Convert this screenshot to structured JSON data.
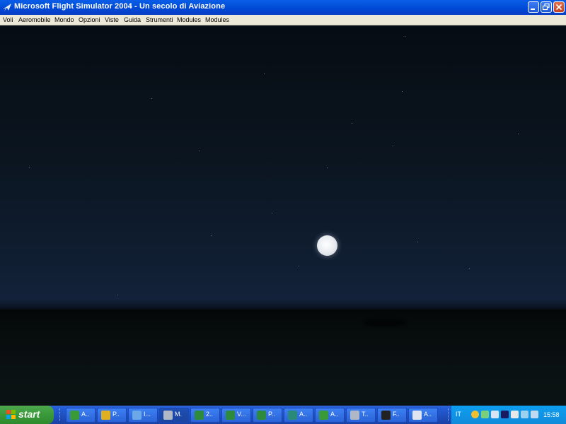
{
  "window": {
    "title": "Microsoft Flight Simulator 2004 - Un secolo di Aviazione"
  },
  "menu": [
    "Voli",
    "Aeromobile",
    "Mondo",
    "Opzioni",
    "Viste",
    "Guida",
    "Strumenti",
    "Modules",
    "Modules"
  ],
  "taskbar": {
    "start_label": "start",
    "tasks": [
      "A..",
      "P..",
      "I...",
      "M.",
      "2..",
      "V...",
      "P..",
      "A..",
      "A..",
      "T..",
      "F..",
      "A.."
    ],
    "language": "IT",
    "clock": "15:58"
  },
  "colors": {
    "titlebar": "#0047d6",
    "taskbar": "#245edb",
    "start": "#3c9c3c",
    "sky": "#0b1520"
  }
}
